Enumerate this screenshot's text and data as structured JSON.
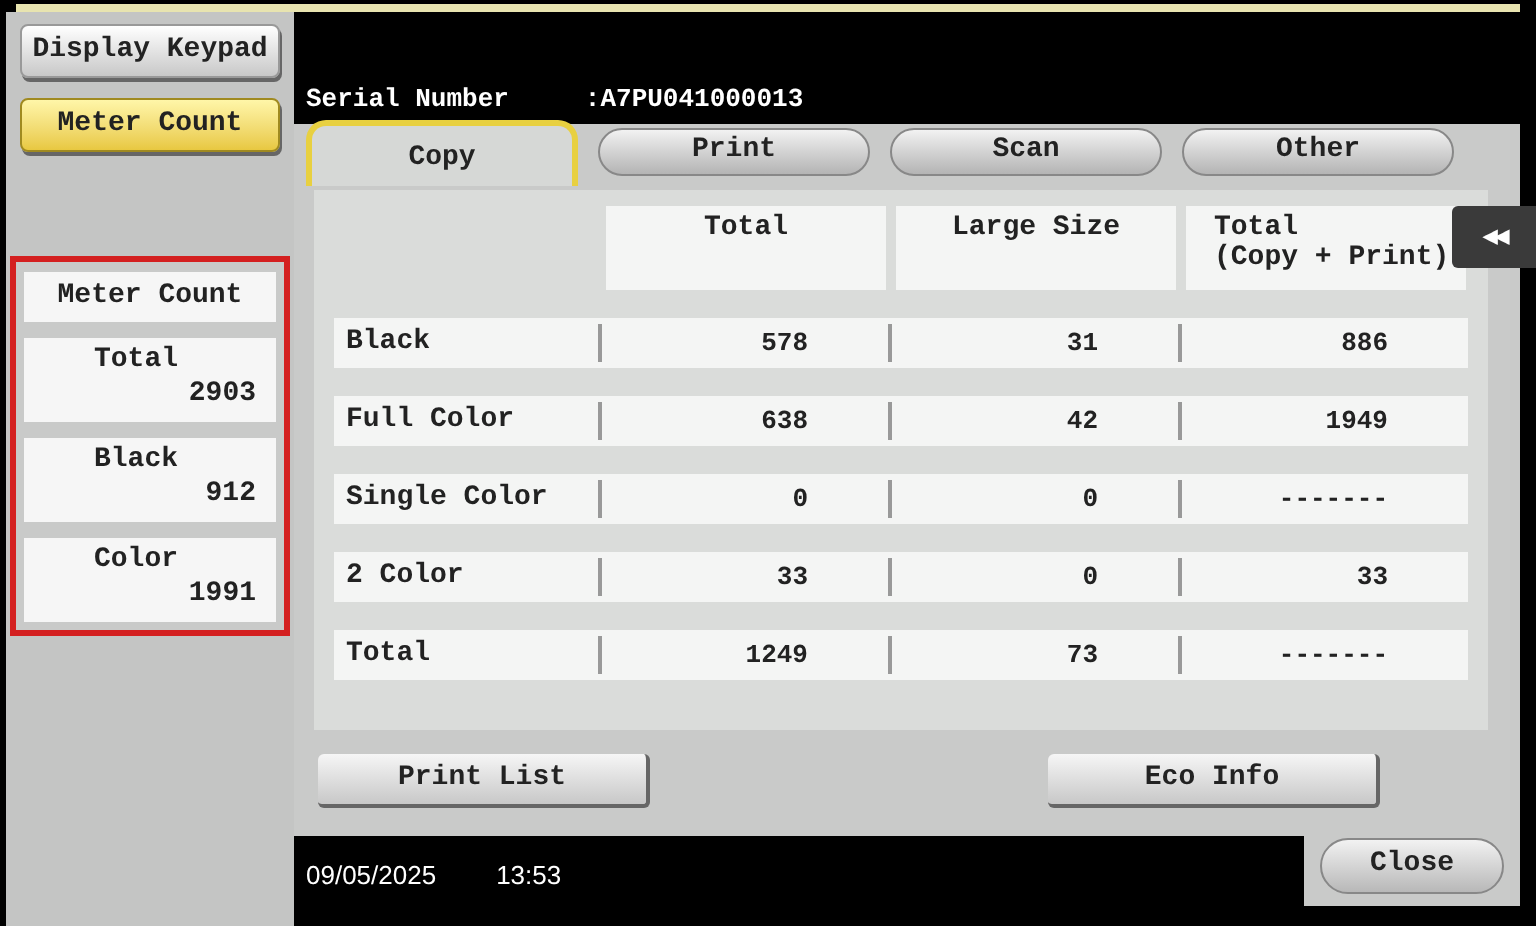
{
  "sidebar": {
    "buttons": [
      {
        "label": "Display Keypad",
        "selected": false
      },
      {
        "label": "Meter Count",
        "selected": true
      }
    ],
    "meter_panel": {
      "title": "Meter Count",
      "items": [
        {
          "label": "Total",
          "value": "2903"
        },
        {
          "label": "Black",
          "value": "912"
        },
        {
          "label": "Color",
          "value": "1991"
        }
      ]
    }
  },
  "serial": {
    "label": "Serial Number",
    "value": ":A7PU041000013"
  },
  "tabs": [
    {
      "label": "Copy",
      "selected": true
    },
    {
      "label": "Print",
      "selected": false
    },
    {
      "label": "Scan",
      "selected": false
    },
    {
      "label": "Other",
      "selected": false
    }
  ],
  "collapse_button": "◀◀",
  "table": {
    "columns": [
      "Total",
      "Large Size",
      "Total\n(Copy + Print)"
    ],
    "rows": [
      {
        "label": "Black",
        "cells": [
          "578",
          "31",
          "886"
        ]
      },
      {
        "label": "Full Color",
        "cells": [
          "638",
          "42",
          "1949"
        ]
      },
      {
        "label": "Single Color",
        "cells": [
          "0",
          "0",
          "-------"
        ]
      },
      {
        "label": "2 Color",
        "cells": [
          "33",
          "0",
          "33"
        ]
      },
      {
        "label": "Total",
        "cells": [
          "1249",
          "73",
          "-------"
        ]
      }
    ]
  },
  "buttons": [
    "Print List",
    "Eco Info"
  ],
  "footer": {
    "date": "09/05/2025",
    "time": "13:53"
  },
  "close_button": "Close"
}
